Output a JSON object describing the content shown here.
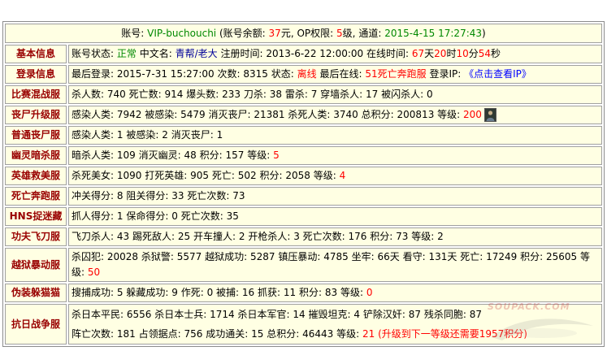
{
  "colors": {
    "text": "#000000",
    "label": "#990000",
    "red": "#FF0000",
    "green": "#008800",
    "blue": "#0000FF",
    "navy": "#000099",
    "cell_bg": "#FFFFE3",
    "border": "#A0A0A0"
  },
  "header": {
    "fields": [
      {
        "k": "账号:",
        "v": "VIP-buchouchi",
        "c": "green"
      },
      {
        "k": "(账号余额:",
        "v": [
          {
            "t": "37",
            "c": "red"
          },
          {
            "t": "元,"
          }
        ]
      },
      {
        "k": "OP权限:",
        "v": [
          {
            "t": "5",
            "c": "red"
          },
          {
            "t": "级,"
          }
        ]
      },
      {
        "k": "通道:",
        "v": [
          {
            "t": "2015-4-15 17:27:43",
            "c": "green"
          },
          {
            "t": ")"
          }
        ]
      }
    ]
  },
  "rows": [
    {
      "label": "基本信息",
      "lines": [
        [
          {
            "k": "账号状态:",
            "v": "正常",
            "c": "green"
          },
          {
            "k": "中文名:",
            "v": "青帮/老大",
            "c": "navy"
          },
          {
            "k": "注册时间:",
            "v": "2013-6-22 12:00:00"
          },
          {
            "k": "在线时间:",
            "v": [
              {
                "t": "67",
                "c": "red"
              },
              {
                "t": "天"
              },
              {
                "t": "20",
                "c": "red"
              },
              {
                "t": "时"
              },
              {
                "t": "10",
                "c": "red"
              },
              {
                "t": "分"
              },
              {
                "t": "54",
                "c": "red"
              },
              {
                "t": "秒"
              }
            ]
          }
        ]
      ]
    },
    {
      "label": "登录信息",
      "lines": [
        [
          {
            "k": "最后登录:",
            "v": "2015-7-31 15:27:00"
          },
          {
            "k": "次数:",
            "v": "8315"
          },
          {
            "k": "状态:",
            "v": "离线",
            "c": "red"
          },
          {
            "k": "最后在线:",
            "v": "51死亡奔跑服",
            "c": "red"
          },
          {
            "k": "登录IP:",
            "v": "《点击查看IP》",
            "c": "blue",
            "link": true
          }
        ]
      ]
    },
    {
      "label": "比赛混战服",
      "lines": [
        [
          {
            "k": "杀人数:",
            "v": "740"
          },
          {
            "k": "死亡数:",
            "v": "914"
          },
          {
            "k": "爆头数:",
            "v": "233"
          },
          {
            "k": "刀杀:",
            "v": "38"
          },
          {
            "k": "雷杀:",
            "v": "7"
          },
          {
            "k": "穿墙杀人:",
            "v": "17"
          },
          {
            "k": "被闪杀人:",
            "v": "0"
          }
        ]
      ]
    },
    {
      "label": "丧尸升级服",
      "icon": "avatar-icon",
      "lines": [
        [
          {
            "k": "感染人类:",
            "v": "7942"
          },
          {
            "k": "被感染:",
            "v": "5479"
          },
          {
            "k": "消灭丧尸:",
            "v": "21381"
          },
          {
            "k": "杀死人类:",
            "v": "3740"
          },
          {
            "k": "总积分:",
            "v": "200813"
          },
          {
            "k": "等级:",
            "v": "200",
            "c": "red"
          }
        ]
      ]
    },
    {
      "label": "普通丧尸服",
      "lines": [
        [
          {
            "k": "感染人类:",
            "v": "1"
          },
          {
            "k": "被感染:",
            "v": "2"
          },
          {
            "k": "消灭丧尸:",
            "v": "1"
          }
        ]
      ]
    },
    {
      "label": "幽灵暗杀服",
      "lines": [
        [
          {
            "k": "暗杀人类:",
            "v": "109"
          },
          {
            "k": "消灭幽灵:",
            "v": "48"
          },
          {
            "k": "积分:",
            "v": "157"
          },
          {
            "k": "等级:",
            "v": "5",
            "c": "red"
          }
        ]
      ]
    },
    {
      "label": "英雄救美服",
      "lines": [
        [
          {
            "k": "杀死美女:",
            "v": "1090"
          },
          {
            "k": "打死英雄:",
            "v": "905"
          },
          {
            "k": "死亡:",
            "v": "502"
          },
          {
            "k": "积分:",
            "v": "2058"
          },
          {
            "k": "等级:",
            "v": "4",
            "c": "red"
          }
        ]
      ]
    },
    {
      "label": "死亡奔跑服",
      "lines": [
        [
          {
            "k": "冲关得分:",
            "v": "8"
          },
          {
            "k": "阻关得分:",
            "v": "33"
          },
          {
            "k": "死亡次数:",
            "v": "73"
          }
        ]
      ]
    },
    {
      "label": "HNS捉迷藏",
      "lines": [
        [
          {
            "k": "抓人得分:",
            "v": "1"
          },
          {
            "k": "保命得分:",
            "v": "0"
          },
          {
            "k": "死亡次数:",
            "v": "35"
          }
        ]
      ]
    },
    {
      "label": "功夫飞刀服",
      "lines": [
        [
          {
            "k": "飞刀杀人:",
            "v": "43"
          },
          {
            "k": "踢死敌人:",
            "v": "25"
          },
          {
            "k": "开车撞人:",
            "v": "2"
          },
          {
            "k": "开枪杀人:",
            "v": "3"
          },
          {
            "k": "死亡次数:",
            "v": "176"
          },
          {
            "k": "积分:",
            "v": "73"
          },
          {
            "k": "等级:",
            "v": "2"
          }
        ]
      ]
    },
    {
      "label": "越狱暴动服",
      "lines": [
        [
          {
            "k": "杀囚犯:",
            "v": "20028"
          },
          {
            "k": "杀狱警:",
            "v": "5577"
          },
          {
            "k": "越狱成功:",
            "v": "5287"
          },
          {
            "k": "镇压暴动:",
            "v": "4785"
          },
          {
            "k": "坐牢:",
            "v": "66天"
          },
          {
            "k": "看守:",
            "v": "131天"
          },
          {
            "k": "死亡:",
            "v": "17249"
          },
          {
            "k": "积分:",
            "v": "25605"
          },
          {
            "k": "等级:",
            "v": "50",
            "c": "red"
          }
        ]
      ]
    },
    {
      "label": "伪装躲猫猫",
      "lines": [
        [
          {
            "k": "搜捕成功:",
            "v": "5"
          },
          {
            "k": "躲藏成功:",
            "v": "9"
          },
          {
            "k": "作死:",
            "v": "0"
          },
          {
            "k": "被捕:",
            "v": "16"
          },
          {
            "k": "抓获:",
            "v": "11"
          },
          {
            "k": "积分:",
            "v": "83"
          },
          {
            "k": "等级:",
            "v": "0",
            "c": "red"
          }
        ]
      ]
    },
    {
      "label": "抗日战争服",
      "lines": [
        [
          {
            "k": "杀日本平民:",
            "v": "6556"
          },
          {
            "k": "杀日本士兵:",
            "v": "1714"
          },
          {
            "k": "杀日本军官:",
            "v": "14"
          },
          {
            "k": "摧毁坦克:",
            "v": "4"
          },
          {
            "k": "铲除汉奸:",
            "v": "87"
          },
          {
            "k": "残杀同胞:",
            "v": "87"
          }
        ],
        [
          {
            "k": "阵亡次数:",
            "v": "181"
          },
          {
            "k": "占领据点:",
            "v": "756"
          },
          {
            "k": "成功通关:",
            "v": "15"
          },
          {
            "k": "总积分:",
            "v": "46443"
          },
          {
            "k": "等级:",
            "v": "21",
            "c": "red"
          },
          {
            "v": "(升级到下一等级还需要1957积分)",
            "c": "red"
          }
        ]
      ]
    }
  ],
  "watermark": "SOUPACK.COM"
}
